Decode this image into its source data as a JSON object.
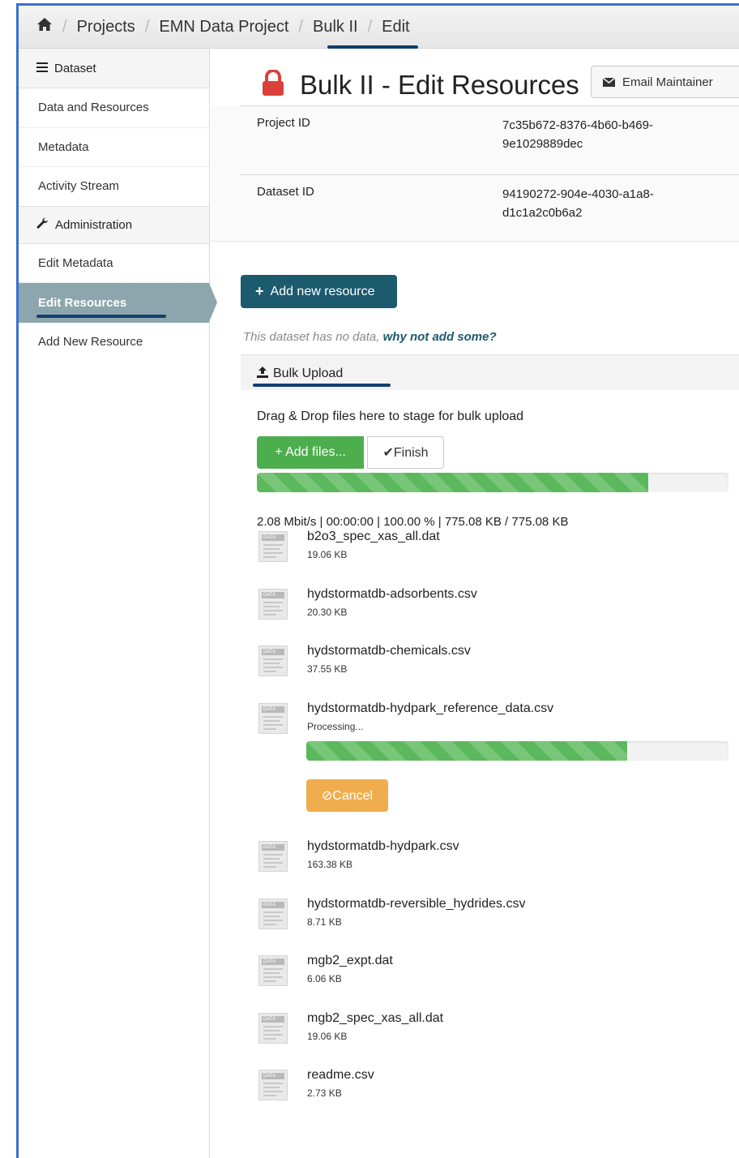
{
  "breadcrumb": {
    "home_icon": "home-icon",
    "items": [
      "Projects",
      "EMN Data Project",
      "Bulk II",
      "Edit"
    ]
  },
  "sidebar": {
    "section_dataset": "Dataset",
    "items_dataset": [
      "Data and Resources",
      "Metadata",
      "Activity Stream"
    ],
    "section_admin": "Administration",
    "items_admin": [
      "Edit Metadata",
      "Edit Resources",
      "Add New Resource"
    ],
    "active": "Edit Resources"
  },
  "header": {
    "title": "Bulk II - Edit Resources",
    "email_button": "Email Maintainer",
    "lock_color": "#d9413a"
  },
  "meta": {
    "rows": [
      {
        "key": "Project ID",
        "value": "7c35b672-8376-4b60-b469-9e1029889dec"
      },
      {
        "key": "Dataset ID",
        "value": "94190272-904e-4030-a1a8-d1c1a2c0b6a2"
      }
    ]
  },
  "actions": {
    "add_resource": "Add new resource",
    "nodata_text": "This dataset has no data,",
    "nodata_link": "why not add some?"
  },
  "bulk": {
    "tab_label": "Bulk Upload",
    "dropzone_text": "Drag & Drop files here to stage for bulk upload",
    "add_files": "+ Add files...",
    "finish": "✔Finish",
    "overall_progress": 0.83,
    "stats": "2.08 Mbit/s | 00:00:00 | 100.00 % | 775.08 KB / 775.08 KB",
    "files": [
      {
        "name": "b2o3_spec_xas_all.dat",
        "size": "19.06 KB"
      },
      {
        "name": "hydstormatdb-adsorbents.csv",
        "size": "20.30 KB"
      },
      {
        "name": "hydstormatdb-chemicals.csv",
        "size": "37.55 KB"
      },
      {
        "name": "hydstormatdb-hydpark_reference_data.csv",
        "size": "Processing..."
      },
      {
        "name": "hydstormatdb-hydpark.csv",
        "size": "163.38 KB"
      },
      {
        "name": "hydstormatdb-reversible_hydrides.csv",
        "size": "8.71 KB"
      },
      {
        "name": "mgb2_expt.dat",
        "size": "6.06 KB"
      },
      {
        "name": "mgb2_spec_xas_all.dat",
        "size": "19.06 KB"
      },
      {
        "name": "readme.csv",
        "size": "2.73 KB"
      }
    ],
    "processing_progress": 0.76,
    "cancel": "⊘Cancel",
    "file_icon_tag": "DATA"
  },
  "colors": {
    "primary": "#1c5a6e",
    "success": "#5cb85c",
    "warning": "#f0ad4e",
    "sidebar_active": "#8da5ad",
    "highlight_underline": "#123f6e",
    "frame_border": "#3b6fd1"
  }
}
